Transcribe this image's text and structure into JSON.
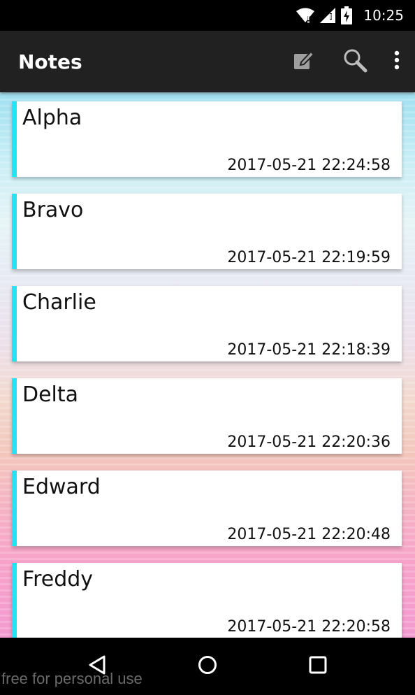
{
  "status_bar": {
    "time": "10:25",
    "icons": [
      "wifi-icon",
      "signal-icon",
      "battery-charging-icon"
    ]
  },
  "app_bar": {
    "title": "Notes",
    "actions": [
      "edit-note-icon",
      "search-icon",
      "more-vert-icon"
    ]
  },
  "notes": [
    {
      "title": "Alpha",
      "timestamp": "2017-05-21 22:24:58"
    },
    {
      "title": "Bravo",
      "timestamp": "2017-05-21 22:19:59"
    },
    {
      "title": "Charlie",
      "timestamp": "2017-05-21 22:18:39"
    },
    {
      "title": "Delta",
      "timestamp": "2017-05-21 22:20:36"
    },
    {
      "title": "Edward",
      "timestamp": "2017-05-21 22:20:48"
    },
    {
      "title": "Freddy",
      "timestamp": "2017-05-21 22:20:58"
    }
  ],
  "colors": {
    "accent": "#22e4f2",
    "app_bar": "#212121",
    "status_bar": "#000000"
  },
  "nav_bar": {
    "buttons": [
      "back-icon",
      "home-icon",
      "recents-icon"
    ]
  },
  "watermark": "free for personal use"
}
